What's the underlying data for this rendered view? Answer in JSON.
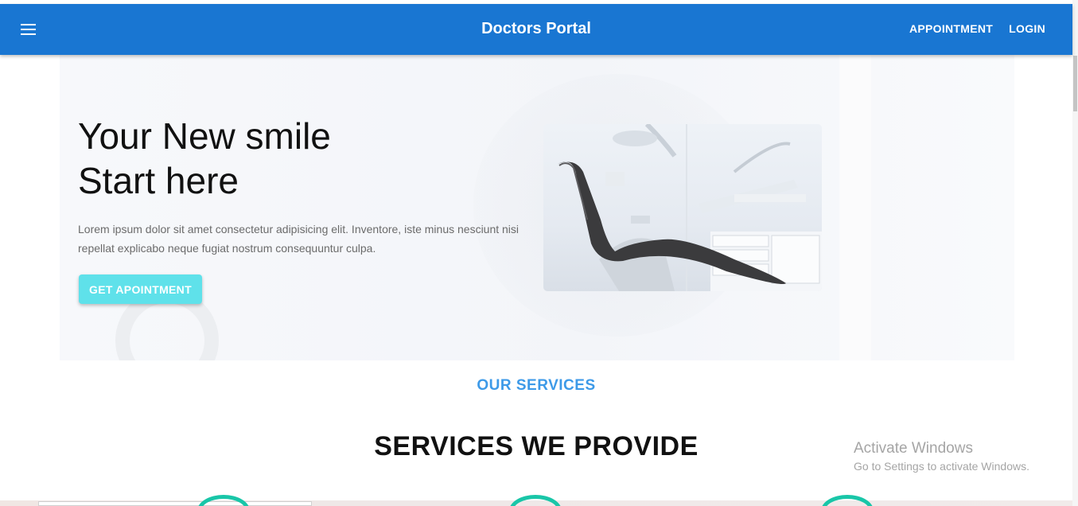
{
  "appbar": {
    "title": "Doctors Portal",
    "nav": [
      {
        "label": "APPOINTMENT"
      },
      {
        "label": "LOGIN"
      }
    ],
    "color": "#1976d2"
  },
  "hero": {
    "title_line1": "Your New smile",
    "title_line2": "Start here",
    "description": "Lorem ipsum dolor sit amet consectetur adipisicing elit. Inventore, iste minus nesciunt nisi repellat explicabo neque fugiat nostrum consequuntur culpa.",
    "button_label": "GET APOINTMENT",
    "button_color": "#5fe1ea"
  },
  "services": {
    "overline": "OUR SERVICES",
    "title": "SERVICES WE PROVIDE",
    "accent_color": "#19c6a8"
  },
  "watermark": {
    "line1": "Activate Windows",
    "line2": "Go to Settings to activate Windows."
  }
}
